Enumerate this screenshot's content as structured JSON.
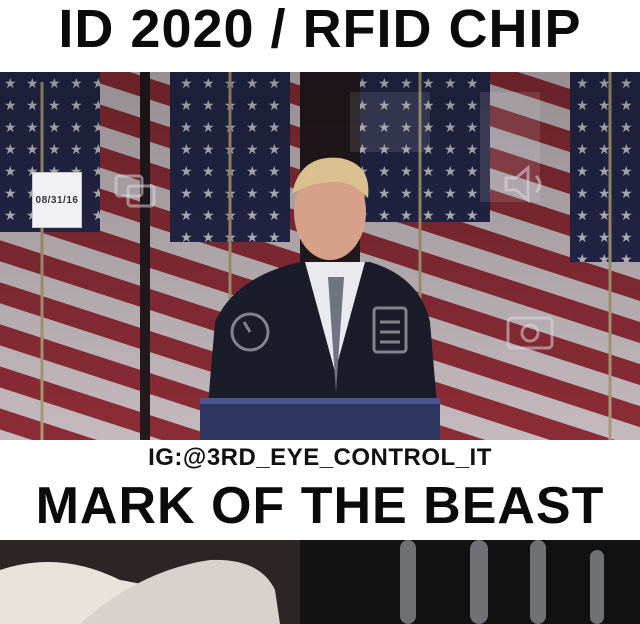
{
  "header": {
    "title": "ID 2020 / RFID CHIP"
  },
  "video": {
    "date_stamp": "08/31/16"
  },
  "caption": {
    "handle": "IG:@3RD_EYE_CONTROL_IT",
    "subtitle": "MARK OF THE BEAST"
  },
  "icons": [
    "clock-icon",
    "calculator-icon",
    "camera-icon",
    "speaker-icon",
    "windows-icon"
  ],
  "colors": {
    "flag_red": "#a3343f",
    "flag_blue": "#2b2f57",
    "text": "#0b0b0b",
    "background": "#ffffff"
  }
}
